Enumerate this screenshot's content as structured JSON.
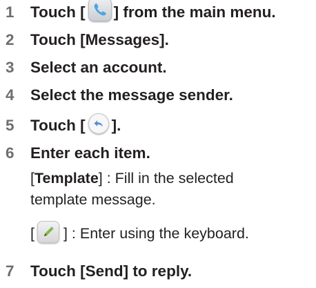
{
  "steps": [
    {
      "num": "1",
      "pre": "Touch [",
      "post": "] from the main menu."
    },
    {
      "num": "2",
      "text": "Touch [Messages]."
    },
    {
      "num": "3",
      "text": "Select an account."
    },
    {
      "num": "4",
      "text": "Select the message sender."
    },
    {
      "num": "5",
      "pre": "Touch [",
      "post": "]."
    },
    {
      "num": "6",
      "text": "Enter each item."
    },
    {
      "num": "7",
      "text": "Touch [Send] to reply."
    }
  ],
  "details": {
    "template_open": "[",
    "template_label": "Template",
    "template_close": "] :  Fill in the selected",
    "template_line2": "template message.",
    "keyboard_open": "[",
    "keyboard_close": "] :  Enter using the keyboard."
  },
  "icons": {
    "phone": "phone-icon",
    "reply": "reply-icon",
    "pencil": "pencil-icon"
  },
  "colors": {
    "step_number": "#6d6e71",
    "text": "#231f20",
    "phone_icon": "#4fa3e0",
    "reply_arrow": "#5a8fd0",
    "pencil_accent": "#7dbb3c"
  }
}
